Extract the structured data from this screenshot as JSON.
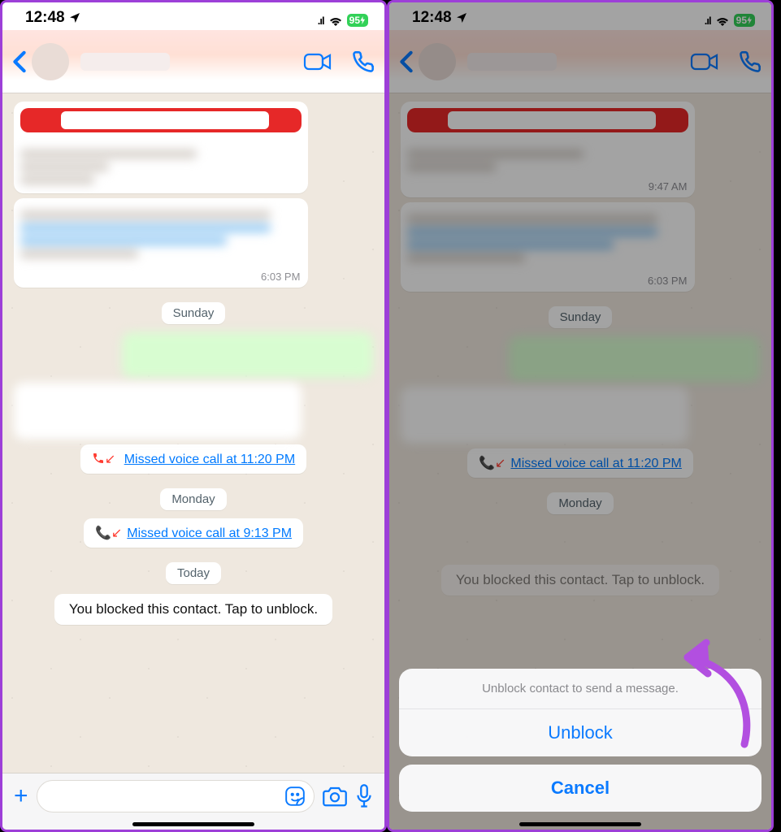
{
  "status": {
    "time": "12:48",
    "battery": "95"
  },
  "chat": {
    "ts1": "6:03 PM",
    "ts2": "9:47 AM",
    "day1": "Sunday",
    "day2": "Monday",
    "day3": "Today",
    "missed1": "Missed voice call at 11:20 PM",
    "missed2": "Missed voice call at 9:13 PM",
    "blocked": "You blocked this contact. Tap to unblock."
  },
  "sheet": {
    "msg": "Unblock contact to send a message.",
    "unblock": "Unblock",
    "cancel": "Cancel"
  }
}
